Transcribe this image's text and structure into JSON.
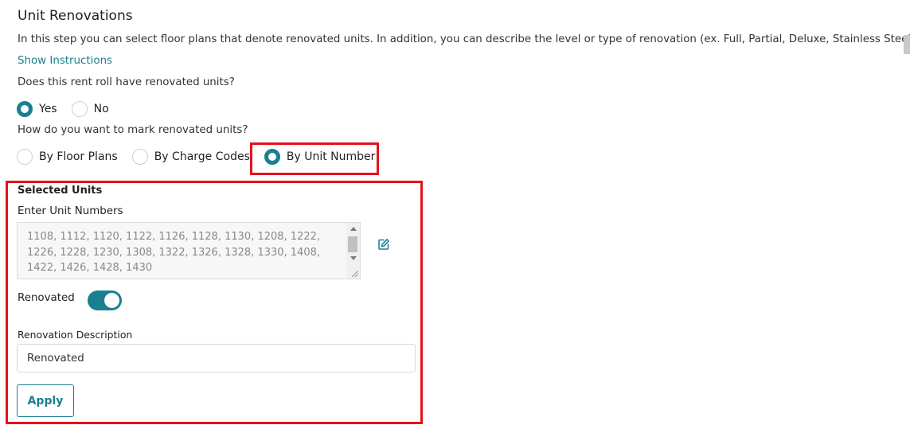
{
  "header": {
    "title": "Unit Renovations",
    "intro": "In this step you can select floor plans that denote renovated units. In addition, you can describe the level or type of renovation (ex. Full, Partial, Deluxe, Stainless Steel).",
    "show_instructions": "Show Instructions"
  },
  "question_renovated": {
    "label": "Does this rent roll have renovated units?",
    "options": [
      {
        "label": "Yes",
        "checked": true
      },
      {
        "label": "No",
        "checked": false
      }
    ]
  },
  "question_mark": {
    "label": "How do you want to mark renovated units?",
    "options": [
      {
        "label": "By Floor Plans",
        "checked": false
      },
      {
        "label": "By Charge Codes",
        "checked": false
      },
      {
        "label": "By Unit Number",
        "checked": true
      }
    ]
  },
  "selected_units": {
    "title": "Selected Units",
    "field_label": "Enter Unit Numbers",
    "unit_numbers": "1108, 1112, 1120, 1122, 1126, 1128, 1130, 1208, 1222,\n1226, 1228, 1230, 1308, 1322, 1326, 1328, 1330, 1408,\n1422, 1426, 1428, 1430",
    "edit_icon": "edit-icon",
    "renovated_label": "Renovated",
    "renovated_on": true,
    "description_label": "Renovation Description",
    "description_value": "Renovated",
    "apply_label": "Apply"
  },
  "colors": {
    "accent": "#1a7f8e",
    "highlight": "#e3131b"
  }
}
